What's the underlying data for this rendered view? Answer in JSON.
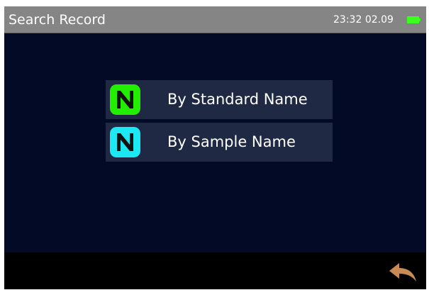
{
  "header": {
    "title": "Search Record",
    "time": "23:32",
    "date": "02.09",
    "battery_icon": "battery-icon",
    "battery_color": "#3aff1e",
    "background_color": "#858585"
  },
  "main": {
    "background_color": "#020a25",
    "menu": [
      {
        "label": "By Standard Name",
        "icon": "n-logo-icon",
        "icon_color": "#22ee00"
      },
      {
        "label": "By Sample Name",
        "icon": "n-logo-icon",
        "icon_color": "#1ce8f4"
      }
    ]
  },
  "footer": {
    "back_icon": "back-arrow-icon",
    "back_icon_color": "#c98a53"
  }
}
